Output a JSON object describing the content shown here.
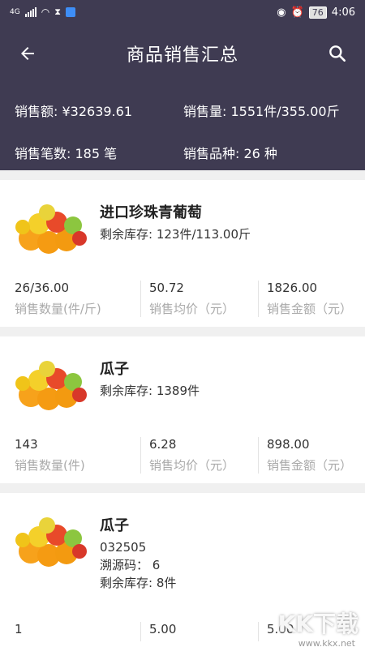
{
  "statusbar": {
    "network": "4G",
    "battery": "76",
    "time": "4:06"
  },
  "header": {
    "title": "商品销售汇总"
  },
  "summary": {
    "amount": "销售额: ¥32639.61",
    "quantity": "销售量: 1551件/355.00斤",
    "orders": "销售笔数: 185 笔",
    "varieties": "销售品种: 26 种"
  },
  "products": [
    {
      "name": "进口珍珠青葡萄",
      "lines": [
        "剩余库存: 123件/113.00斤"
      ],
      "stats": [
        {
          "value": "26/36.00",
          "label": "销售数量(件/斤)"
        },
        {
          "value": "50.72",
          "label": "销售均价（元）"
        },
        {
          "value": "1826.00",
          "label": "销售金额（元）"
        }
      ]
    },
    {
      "name": "瓜子",
      "lines": [
        "剩余库存: 1389件"
      ],
      "stats": [
        {
          "value": "143",
          "label": "销售数量(件)"
        },
        {
          "value": "6.28",
          "label": "销售均价（元）"
        },
        {
          "value": "898.00",
          "label": "销售金额（元）"
        }
      ]
    },
    {
      "name": "瓜子",
      "lines": [
        "032505",
        "溯源码： 6",
        "剩余库存: 8件"
      ],
      "stats": [
        {
          "value": "1",
          "label": ""
        },
        {
          "value": "5.00",
          "label": ""
        },
        {
          "value": "5.00",
          "label": ""
        }
      ]
    }
  ],
  "watermark": {
    "text": "KK下载",
    "url": "www.kkx.net"
  },
  "colors": {
    "header_bg": "#3f3b52",
    "page_bg": "#f0f0f0"
  }
}
